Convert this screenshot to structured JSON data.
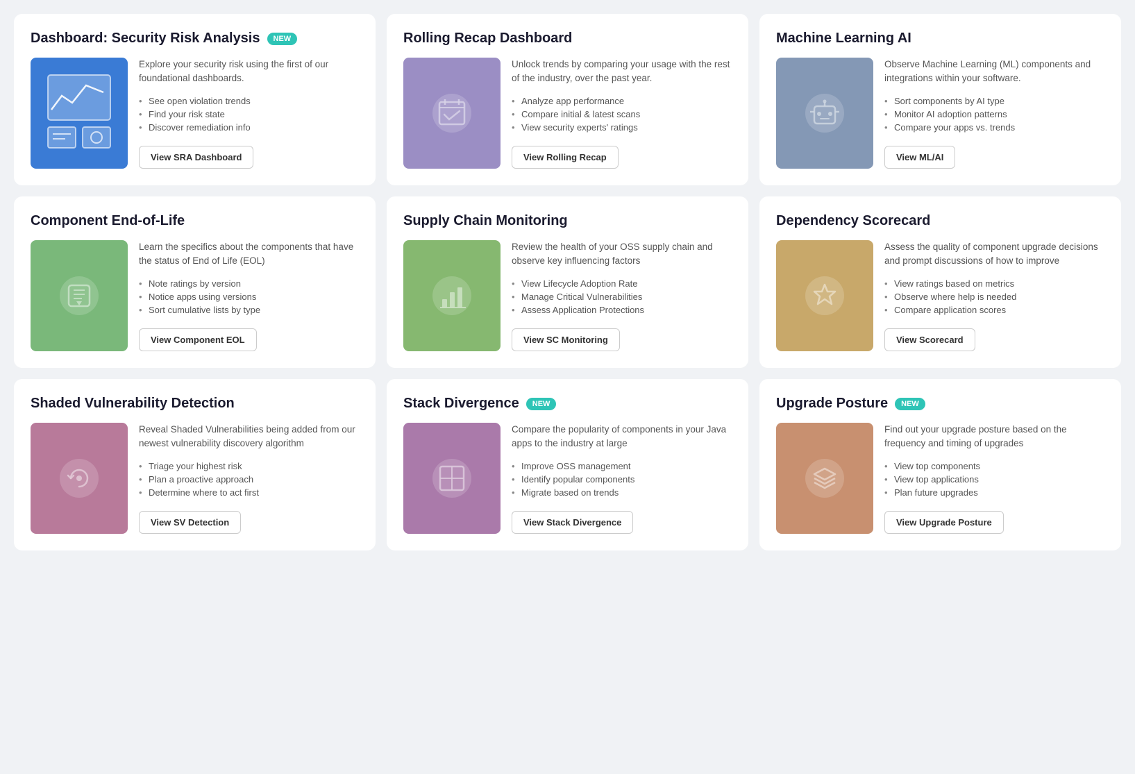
{
  "cards": [
    {
      "id": "sra",
      "title": "Dashboard: Security Risk Analysis",
      "badge": "NEW",
      "description": "Explore your security risk using the first of our foundational dashboards.",
      "bullets": [
        "See open violation trends",
        "Find your risk state",
        "Discover remediation info"
      ],
      "button": "View SRA Dashboard",
      "bgClass": "bg-blue",
      "iconType": "sra"
    },
    {
      "id": "rolling-recap",
      "title": "Rolling Recap Dashboard",
      "badge": null,
      "description": "Unlock trends by comparing your usage with the rest of the industry, over the past year.",
      "bullets": [
        "Analyze app performance",
        "Compare initial & latest scans",
        "View security experts' ratings"
      ],
      "button": "View Rolling Recap",
      "bgClass": "bg-lavender",
      "iconType": "calendar"
    },
    {
      "id": "ml-ai",
      "title": "Machine Learning AI",
      "badge": null,
      "description": "Observe Machine Learning (ML) components and integrations within your software.",
      "bullets": [
        "Sort components by AI type",
        "Monitor AI adoption patterns",
        "Compare your apps vs. trends"
      ],
      "button": "View ML/AI",
      "bgClass": "bg-grey-blue",
      "iconType": "robot"
    },
    {
      "id": "component-eol",
      "title": "Component End-of-Life",
      "badge": null,
      "description": "Learn the specifics about the components that have the status of End of Life (EOL)",
      "bullets": [
        "Note ratings by version",
        "Notice apps using versions",
        "Sort cumulative lists by type"
      ],
      "button": "View Component EOL",
      "bgClass": "bg-green",
      "iconType": "flag"
    },
    {
      "id": "supply-chain",
      "title": "Supply Chain Monitoring",
      "badge": null,
      "description": "Review the health of your OSS supply chain and observe key influencing factors",
      "bullets": [
        "View Lifecycle Adoption Rate",
        "Manage Critical Vulnerabilities",
        "Assess Application Protections"
      ],
      "button": "View SC Monitoring",
      "bgClass": "bg-green2",
      "iconType": "chart"
    },
    {
      "id": "dependency-scorecard",
      "title": "Dependency Scorecard",
      "badge": null,
      "description": "Assess the quality of component upgrade decisions and prompt discussions of how to improve",
      "bullets": [
        "View ratings based on metrics",
        "Observe where help is needed",
        "Compare application scores"
      ],
      "button": "View Scorecard",
      "bgClass": "bg-tan",
      "iconType": "star"
    },
    {
      "id": "shaded-vuln",
      "title": "Shaded Vulnerability Detection",
      "badge": null,
      "description": "Reveal Shaded Vulnerabilities being added from our newest vulnerability discovery algorithm",
      "bullets": [
        "Triage your highest risk",
        "Plan a proactive approach",
        "Determine where to act first"
      ],
      "button": "View SV Detection",
      "bgClass": "bg-pink",
      "iconType": "refresh"
    },
    {
      "id": "stack-divergence",
      "title": "Stack Divergence",
      "badge": "NEW",
      "description": "Compare the popularity of components in your Java apps to the industry at large",
      "bullets": [
        "Improve OSS management",
        "Identify popular components",
        "Migrate based on trends"
      ],
      "button": "View Stack Divergence",
      "bgClass": "bg-pink2",
      "iconType": "table"
    },
    {
      "id": "upgrade-posture",
      "title": "Upgrade Posture",
      "badge": "NEW",
      "description": "Find out your upgrade posture based on the frequency and timing of upgrades",
      "bullets": [
        "View top components",
        "View top applications",
        "Plan future upgrades"
      ],
      "button": "View Upgrade Posture",
      "bgClass": "bg-peach",
      "iconType": "layers"
    }
  ]
}
